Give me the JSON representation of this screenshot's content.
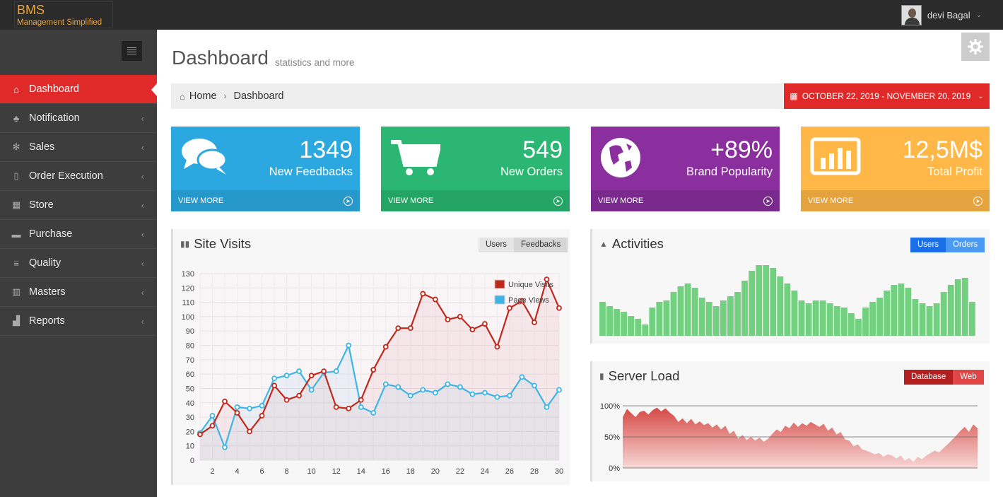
{
  "app": {
    "logo_main": "BMS",
    "logo_sub": "Management Simplified"
  },
  "user": {
    "name": "devi Bagal"
  },
  "sidebar": {
    "items": [
      {
        "label": "Dashboard",
        "icon": "home-icon"
      },
      {
        "label": "Notification",
        "icon": "sitemap-icon"
      },
      {
        "label": "Sales",
        "icon": "cogs-icon"
      },
      {
        "label": "Order Execution",
        "icon": "bookmark-icon"
      },
      {
        "label": "Store",
        "icon": "table-icon"
      },
      {
        "label": "Purchase",
        "icon": "briefcase-icon"
      },
      {
        "label": "Quality",
        "icon": "bars-icon"
      },
      {
        "label": "Masters",
        "icon": "bar-chart-icon"
      },
      {
        "label": "Reports",
        "icon": "signal-icon"
      }
    ]
  },
  "header": {
    "title": "Dashboard",
    "subtitle": "statistics and more"
  },
  "breadcrumb": {
    "home": "Home",
    "current": "Dashboard"
  },
  "daterange": {
    "label": "OCTOBER 22, 2019 - NOVEMBER 20, 2019"
  },
  "stats": [
    {
      "value": "1349",
      "label": "New Feedbacks",
      "more": "VIEW MORE",
      "color": "#2ba8e0",
      "footer_color": "#2698ca",
      "icon": "comments-icon"
    },
    {
      "value": "549",
      "label": "New Orders",
      "more": "VIEW MORE",
      "color": "#2bb673",
      "footer_color": "#24a566",
      "icon": "shopping-cart-icon"
    },
    {
      "value": "+89%",
      "label": "Brand Popularity",
      "more": "VIEW MORE",
      "color": "#8b2f9e",
      "footer_color": "#7a2a8c",
      "icon": "globe-icon"
    },
    {
      "value": "12,5M$",
      "label": "Total Profit",
      "more": "VIEW MORE",
      "color": "#ffb848",
      "footer_color": "#e5a33f",
      "icon": "bar-chart-icon"
    }
  ],
  "site_visits": {
    "title": "Site Visits",
    "buttons": [
      "Users",
      "Feedbacks"
    ],
    "legend": [
      "Unique Visits",
      "Page Views"
    ]
  },
  "activities": {
    "title": "Activities",
    "buttons": [
      "Users",
      "Orders"
    ]
  },
  "server_load": {
    "title": "Server Load",
    "buttons": [
      "Database",
      "Web"
    ],
    "ticks": [
      "100%",
      "50%",
      "0%"
    ]
  },
  "chart_data": [
    {
      "type": "line",
      "title": "Site Visits",
      "x": [
        1,
        2,
        3,
        4,
        5,
        6,
        7,
        8,
        9,
        10,
        11,
        12,
        13,
        14,
        15,
        16,
        17,
        18,
        19,
        20,
        21,
        22,
        23,
        24,
        25,
        26,
        27,
        28,
        29,
        30
      ],
      "x_ticks": [
        2,
        4,
        6,
        8,
        10,
        12,
        14,
        16,
        18,
        20,
        22,
        24,
        26,
        28,
        30
      ],
      "y_ticks": [
        0,
        10,
        20,
        30,
        40,
        50,
        60,
        70,
        80,
        90,
        100,
        110,
        120,
        130
      ],
      "ylim": [
        0,
        130
      ],
      "series": [
        {
          "name": "Unique Visits",
          "color": "#c0281c",
          "values": [
            18,
            24,
            41,
            33,
            20,
            31,
            52,
            42,
            45,
            59,
            62,
            37,
            36,
            42,
            63,
            79,
            92,
            92,
            116,
            112,
            98,
            100,
            91,
            95,
            79,
            106,
            111,
            96,
            126,
            106
          ]
        },
        {
          "name": "Page Views",
          "color": "#3db5e6",
          "values": [
            19,
            31,
            9,
            37,
            36,
            38,
            57,
            59,
            62,
            49,
            61,
            62,
            80,
            37,
            33,
            53,
            51,
            45,
            49,
            47,
            53,
            51,
            46,
            47,
            44,
            45,
            58,
            52,
            37,
            49
          ]
        }
      ],
      "legend_position": "top-right",
      "grid": true
    },
    {
      "type": "bar",
      "title": "Activities",
      "color": "#72d17f",
      "values": [
        24,
        21,
        19,
        17,
        14,
        12,
        8,
        20,
        24,
        25,
        31,
        35,
        37,
        34,
        27,
        24,
        21,
        25,
        28,
        31,
        39,
        46,
        50,
        50,
        48,
        42,
        37,
        32,
        25,
        23,
        25,
        25,
        23,
        21,
        20,
        16,
        12,
        20,
        24,
        27,
        32,
        36,
        37,
        34,
        26,
        23,
        21,
        23,
        31,
        36,
        40,
        41,
        24
      ]
    },
    {
      "type": "area",
      "title": "Server Load",
      "color": "#d43f3a",
      "y_ticks": [
        "0%",
        "50%",
        "100%"
      ],
      "ylim": [
        0,
        100
      ],
      "values": [
        82,
        95,
        88,
        82,
        90,
        92,
        86,
        93,
        97,
        91,
        96,
        89,
        84,
        74,
        80,
        72,
        79,
        70,
        75,
        69,
        72,
        65,
        70,
        62,
        68,
        55,
        60,
        47,
        53,
        45,
        50,
        44,
        49,
        42,
        47,
        55,
        62,
        58,
        68,
        64,
        73,
        66,
        72,
        68,
        74,
        70,
        66,
        71,
        60,
        65,
        54,
        58,
        46,
        44,
        35,
        38,
        30,
        28,
        25,
        22,
        24,
        18,
        22,
        20,
        15,
        20,
        12,
        16,
        10,
        18,
        14,
        20,
        24,
        28,
        25,
        32,
        38,
        45,
        52,
        60,
        66,
        58,
        70,
        64
      ]
    }
  ]
}
